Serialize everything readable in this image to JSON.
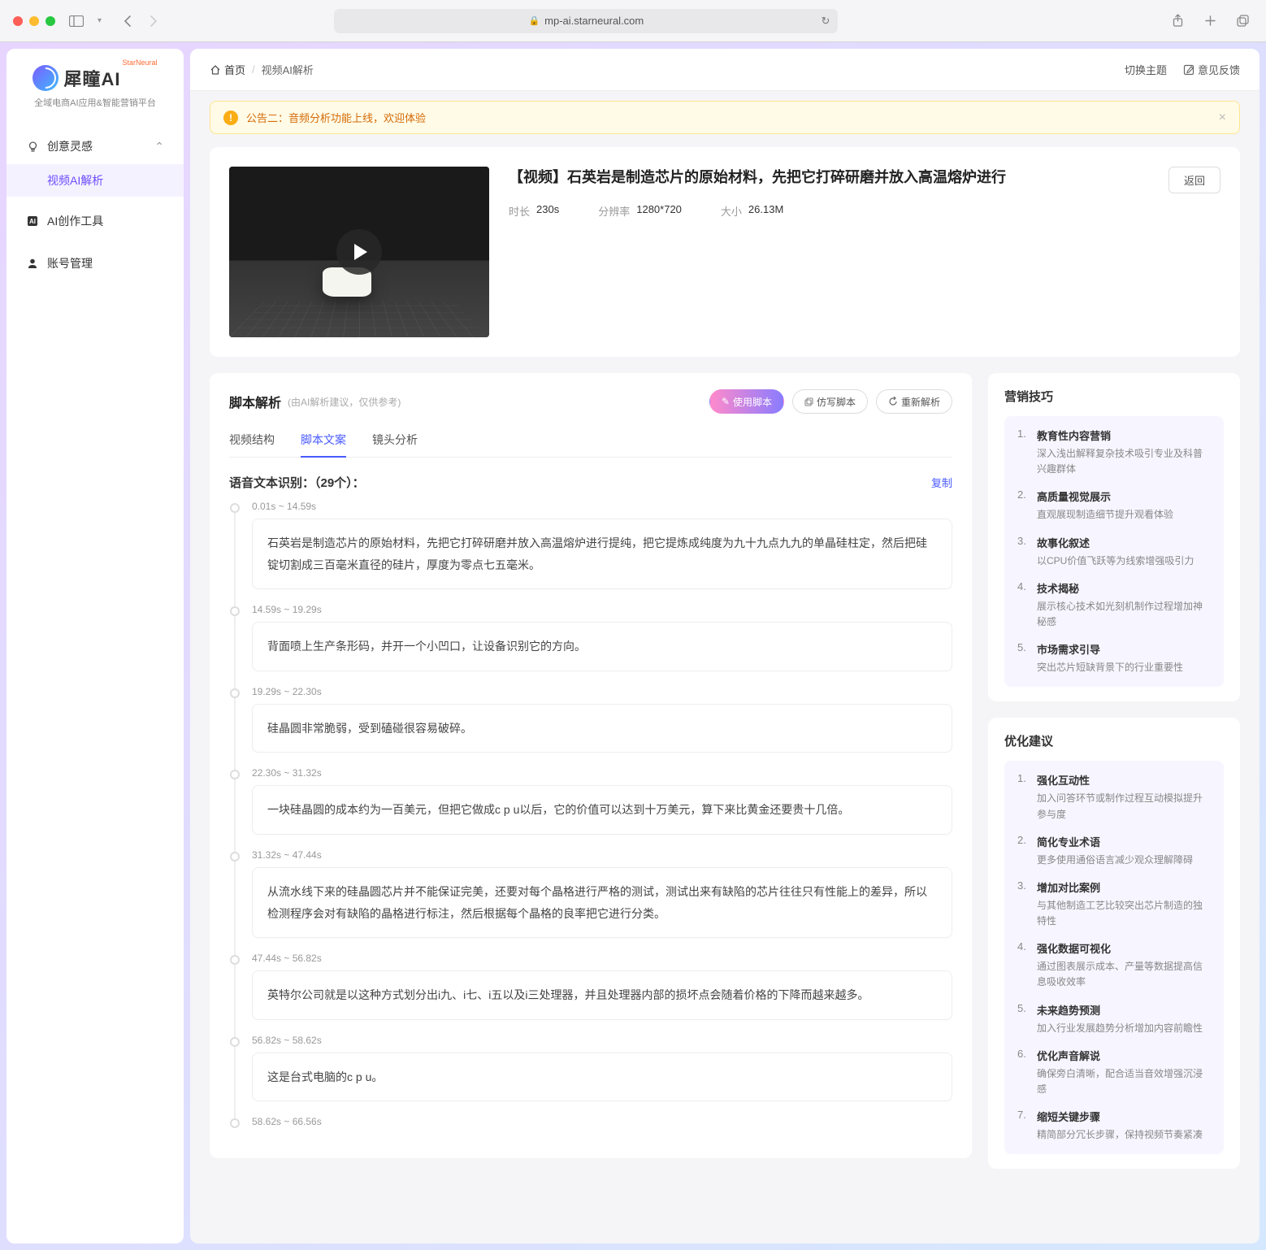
{
  "browser": {
    "url": "mp-ai.starneural.com"
  },
  "logo": {
    "title": "犀瞳AI",
    "badge": "StarNeural",
    "subtitle": "全域电商AI应用&智能营销平台"
  },
  "sidebar": {
    "groups": [
      {
        "label": "创意灵感",
        "expanded": true,
        "items": [
          {
            "label": "视频AI解析",
            "active": true
          }
        ]
      },
      {
        "label": "AI创作工具"
      },
      {
        "label": "账号管理"
      }
    ]
  },
  "header": {
    "home": "首页",
    "crumb": "视频AI解析",
    "theme": "切换主题",
    "feedback": "意见反馈"
  },
  "notice": {
    "prefix": "公告二：",
    "text": "音频分析功能上线，欢迎体验"
  },
  "video": {
    "title": "【视频】石英岩是制造芯片的原始材料，先把它打碎研磨并放入高温熔炉进行",
    "back": "返回",
    "meta": [
      {
        "label": "时长",
        "value": "230s"
      },
      {
        "label": "分辨率",
        "value": "1280*720"
      },
      {
        "label": "大小",
        "value": "26.13M"
      }
    ]
  },
  "analysis": {
    "title": "脚本解析",
    "subtitle": "(由AI解析建议，仅供参考)",
    "actions": {
      "use": "使用脚本",
      "imitate": "仿写脚本",
      "regen": "重新解析"
    },
    "tabs": [
      {
        "label": "视频结构",
        "active": false
      },
      {
        "label": "脚本文案",
        "active": true
      },
      {
        "label": "镜头分析",
        "active": false
      }
    ],
    "transcript_label": "语音文本识别：（29个）：",
    "copy": "复制"
  },
  "segments": [
    {
      "time": "0.01s ~ 14.59s",
      "text": "石英岩是制造芯片的原始材料，先把它打碎研磨并放入高温熔炉进行提纯，把它提炼成纯度为九十九点九九的单晶硅柱定，然后把硅锭切割成三百毫米直径的硅片，厚度为零点七五毫米。"
    },
    {
      "time": "14.59s ~ 19.29s",
      "text": "背面喷上生产条形码，并开一个小凹口，让设备识别它的方向。"
    },
    {
      "time": "19.29s ~ 22.30s",
      "text": "硅晶圆非常脆弱，受到磕碰很容易破碎。"
    },
    {
      "time": "22.30s ~ 31.32s",
      "text": "一块硅晶圆的成本约为一百美元，但把它做成c p u以后，它的价值可以达到十万美元，算下来比黄金还要贵十几倍。"
    },
    {
      "time": "31.32s ~ 47.44s",
      "text": "从流水线下来的硅晶圆芯片并不能保证完美，还要对每个晶格进行严格的测试，测试出来有缺陷的芯片往往只有性能上的差异，所以检测程序会对有缺陷的晶格进行标注，然后根据每个晶格的良率把它进行分类。"
    },
    {
      "time": "47.44s ~ 56.82s",
      "text": "英特尔公司就是以这种方式划分出i九、i七、i五以及i三处理器，并且处理器内部的损坏点会随着价格的下降而越来越多。"
    },
    {
      "time": "56.82s ~ 58.62s",
      "text": "这是台式电脑的c p u。"
    },
    {
      "time": "58.62s ~ 66.56s",
      "text": ""
    }
  ],
  "marketing": {
    "title": "营销技巧",
    "items": [
      {
        "title": "教育性内容营销",
        "desc": "深入浅出解释复杂技术吸引专业及科普兴趣群体"
      },
      {
        "title": "高质量视觉展示",
        "desc": "直观展现制造细节提升观看体验"
      },
      {
        "title": "故事化叙述",
        "desc": "以CPU价值飞跃等为线索增强吸引力"
      },
      {
        "title": "技术揭秘",
        "desc": "展示核心技术如光刻机制作过程增加神秘感"
      },
      {
        "title": "市场需求引导",
        "desc": "突出芯片短缺背景下的行业重要性"
      }
    ]
  },
  "optimize": {
    "title": "优化建议",
    "items": [
      {
        "title": "强化互动性",
        "desc": "加入问答环节或制作过程互动模拟提升参与度"
      },
      {
        "title": "简化专业术语",
        "desc": "更多使用通俗语言减少观众理解障碍"
      },
      {
        "title": "增加对比案例",
        "desc": "与其他制造工艺比较突出芯片制造的独特性"
      },
      {
        "title": "强化数据可视化",
        "desc": "通过图表展示成本、产量等数据提高信息吸收效率"
      },
      {
        "title": "未来趋势预测",
        "desc": "加入行业发展趋势分析增加内容前瞻性"
      },
      {
        "title": "优化声音解说",
        "desc": "确保旁白清晰，配合适当音效增强沉浸感"
      },
      {
        "title": "缩短关键步骤",
        "desc": "精简部分冗长步骤，保持视频节奏紧凑"
      }
    ]
  }
}
